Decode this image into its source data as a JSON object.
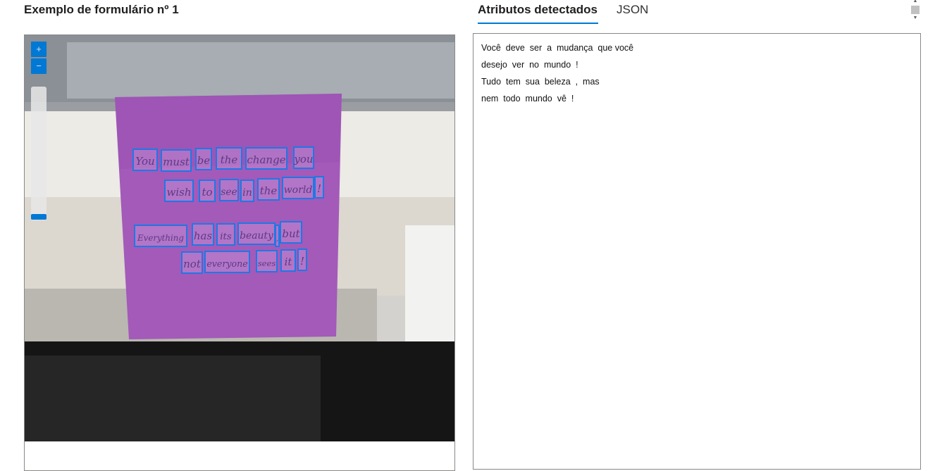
{
  "left_panel": {
    "title": "Exemplo de formulário nº 1",
    "zoom_in_label": "+",
    "zoom_out_label": "−"
  },
  "tabs": [
    {
      "label": "Atributos detectados",
      "active": true
    },
    {
      "label": "JSON",
      "active": false
    }
  ],
  "result": {
    "lines": [
      "Você  deve  ser  a  mudança  que você",
      "desejo  ver  no  mundo  !",
      "Tudo  tem  sua  beleza  ,  mas",
      "nem  todo  mundo  vê  !"
    ]
  },
  "note": {
    "words": [
      "You",
      "must",
      "be",
      "the",
      "change",
      "you",
      "wish",
      "to",
      "see",
      "in",
      "the",
      "world",
      "!",
      "Everything",
      "has",
      "its",
      "beauty",
      ",",
      "but",
      "not",
      "everyone",
      "sees",
      "it",
      "!"
    ],
    "color": "#a35ab9",
    "box_color": "#1e78e6"
  },
  "colors": {
    "accent": "#0078d4"
  },
  "icons": {
    "scroll_up": "scroll-up-arrow-icon",
    "scroll_down": "scroll-down-arrow-icon"
  }
}
